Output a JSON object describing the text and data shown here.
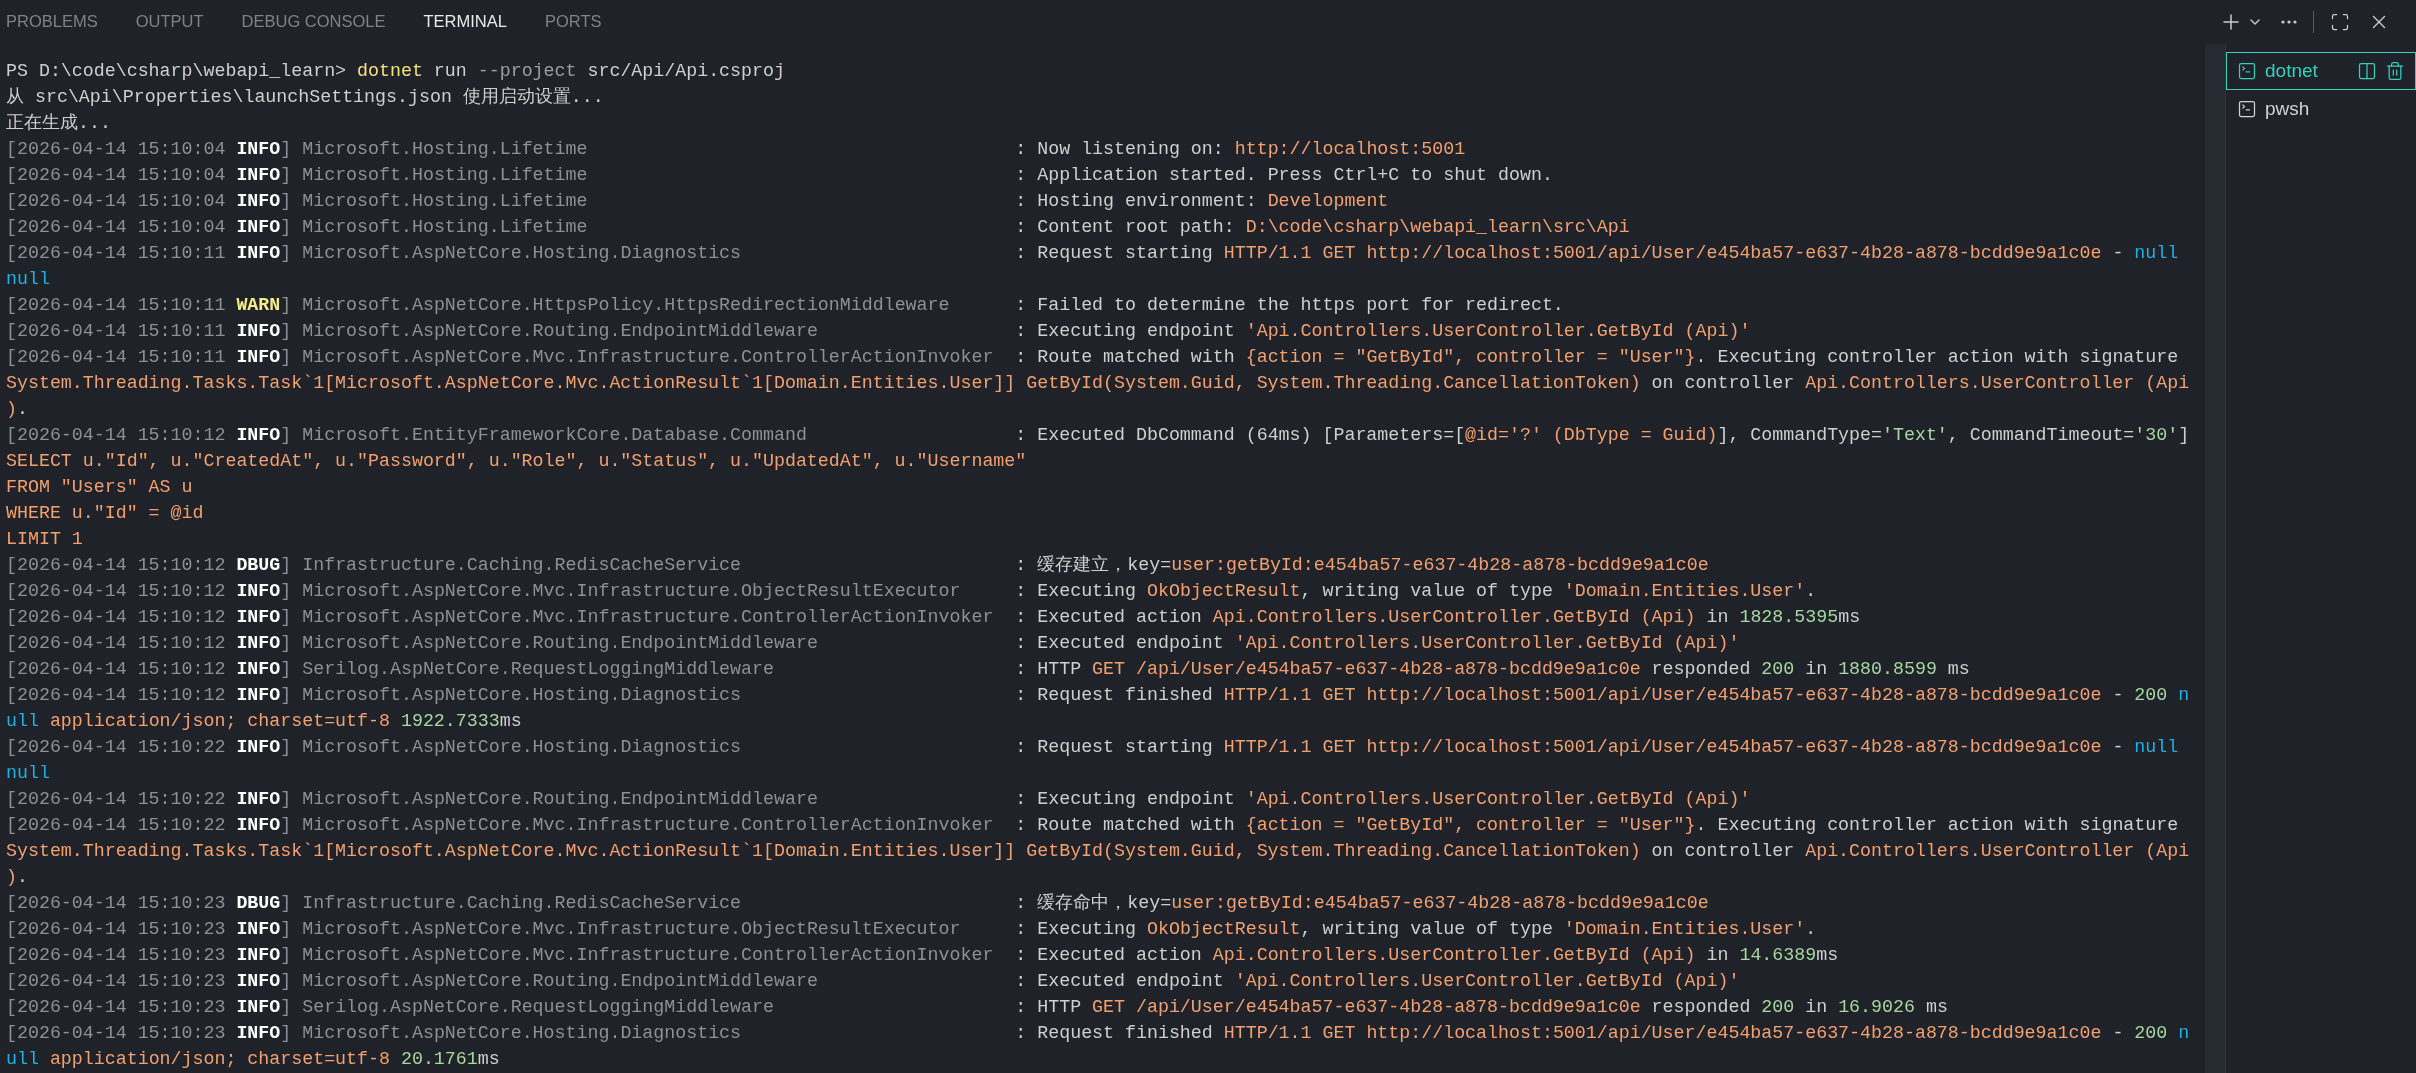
{
  "tabs": [
    {
      "label": "PROBLEMS",
      "selected": false
    },
    {
      "label": "OUTPUT",
      "selected": false
    },
    {
      "label": "DEBUG CONSOLE",
      "selected": false
    },
    {
      "label": "TERMINAL",
      "selected": true
    },
    {
      "label": "PORTS",
      "selected": false
    }
  ],
  "terminals": [
    {
      "label": "dotnet",
      "selected": true
    },
    {
      "label": "pwsh",
      "selected": false
    }
  ],
  "lines": [
    [
      {
        "text": "PS D:\\code\\csharp\\webapi_learn> ",
        "kind": "plain"
      },
      {
        "text": "dotnet",
        "kind": "command"
      },
      {
        "text": " run ",
        "kind": "plain"
      },
      {
        "text": "--project",
        "kind": "option"
      },
      {
        "text": " src/Api/Api.csproj",
        "kind": "plain"
      }
    ],
    [
      {
        "text": "从 src\\Api\\Properties\\launchSettings.json 使用启动设置...",
        "kind": "plain"
      }
    ],
    [
      {
        "text": "正在生成...",
        "kind": "plain"
      }
    ],
    [
      {
        "text": "[2026-04-14 15:10:04 ",
        "kind": "dim"
      },
      {
        "text": "INFO",
        "kind": "level"
      },
      {
        "text": "] ",
        "kind": "dim"
      },
      {
        "text": "Microsoft.Hosting.Lifetime",
        "kind": "source"
      },
      {
        "text": ": Now listening on: ",
        "kind": "plain"
      },
      {
        "text": "http://localhost:5001",
        "kind": "string"
      }
    ],
    [
      {
        "text": "[2026-04-14 15:10:04 ",
        "kind": "dim"
      },
      {
        "text": "INFO",
        "kind": "level"
      },
      {
        "text": "] ",
        "kind": "dim"
      },
      {
        "text": "Microsoft.Hosting.Lifetime",
        "kind": "source"
      },
      {
        "text": ": Application started. Press Ctrl+C to shut down.",
        "kind": "plain"
      }
    ],
    [
      {
        "text": "[2026-04-14 15:10:04 ",
        "kind": "dim"
      },
      {
        "text": "INFO",
        "kind": "level"
      },
      {
        "text": "] ",
        "kind": "dim"
      },
      {
        "text": "Microsoft.Hosting.Lifetime",
        "kind": "source"
      },
      {
        "text": ": Hosting environment: ",
        "kind": "plain"
      },
      {
        "text": "Development",
        "kind": "string"
      }
    ],
    [
      {
        "text": "[2026-04-14 15:10:04 ",
        "kind": "dim"
      },
      {
        "text": "INFO",
        "kind": "level"
      },
      {
        "text": "] ",
        "kind": "dim"
      },
      {
        "text": "Microsoft.Hosting.Lifetime",
        "kind": "source"
      },
      {
        "text": ": Content root path: ",
        "kind": "plain"
      },
      {
        "text": "D:\\code\\csharp\\webapi_learn\\src\\Api",
        "kind": "string"
      }
    ],
    [
      {
        "text": "[2026-04-14 15:10:11 ",
        "kind": "dim"
      },
      {
        "text": "INFO",
        "kind": "level"
      },
      {
        "text": "] ",
        "kind": "dim"
      },
      {
        "text": "Microsoft.AspNetCore.Hosting.Diagnostics",
        "kind": "source"
      },
      {
        "text": ": Request starting ",
        "kind": "plain"
      },
      {
        "text": "HTTP/1.1 GET http://localhost:5001/api/User/e454ba57-e637-4b28-a878-bcdd9e9a1c0e",
        "kind": "string"
      },
      {
        "text": " - ",
        "kind": "plain"
      },
      {
        "text": "null",
        "kind": "null"
      }
    ],
    [
      {
        "text": "null",
        "kind": "null"
      }
    ],
    [
      {
        "text": "[2026-04-14 15:10:11 ",
        "kind": "dim"
      },
      {
        "text": "WARN",
        "kind": "warn"
      },
      {
        "text": "] ",
        "kind": "dim"
      },
      {
        "text": "Microsoft.AspNetCore.HttpsPolicy.HttpsRedirectionMiddleware",
        "kind": "source"
      },
      {
        "text": ": Failed to determine the https port for redirect.",
        "kind": "plain"
      }
    ],
    [
      {
        "text": "[2026-04-14 15:10:11 ",
        "kind": "dim"
      },
      {
        "text": "INFO",
        "kind": "level"
      },
      {
        "text": "] ",
        "kind": "dim"
      },
      {
        "text": "Microsoft.AspNetCore.Routing.EndpointMiddleware",
        "kind": "source"
      },
      {
        "text": ": Executing endpoint ",
        "kind": "plain"
      },
      {
        "text": "'Api.Controllers.UserController.GetById (Api)'",
        "kind": "string"
      }
    ],
    [
      {
        "text": "[2026-04-14 15:10:11 ",
        "kind": "dim"
      },
      {
        "text": "INFO",
        "kind": "level"
      },
      {
        "text": "] ",
        "kind": "dim"
      },
      {
        "text": "Microsoft.AspNetCore.Mvc.Infrastructure.ControllerActionInvoker",
        "kind": "source"
      },
      {
        "text": ": Route matched with ",
        "kind": "plain"
      },
      {
        "text": "{action = \"GetById\", controller = \"User\"}",
        "kind": "string"
      },
      {
        "text": ". Executing controller action with signature",
        "kind": "plain"
      }
    ],
    [
      {
        "text": "System.Threading.Tasks.Task`1[Microsoft.AspNetCore.Mvc.ActionResult`1[Domain.Entities.User]] GetById(System.Guid, System.Threading.CancellationToken)",
        "kind": "string"
      },
      {
        "text": " on controller ",
        "kind": "plain"
      },
      {
        "text": "Api.Controllers.UserController (Api",
        "kind": "string"
      }
    ],
    [
      {
        "text": ")",
        "kind": "string"
      },
      {
        "text": ".",
        "kind": "plain"
      }
    ],
    [
      {
        "text": "[2026-04-14 15:10:12 ",
        "kind": "dim"
      },
      {
        "text": "INFO",
        "kind": "level"
      },
      {
        "text": "] ",
        "kind": "dim"
      },
      {
        "text": "Microsoft.EntityFrameworkCore.Database.Command",
        "kind": "source"
      },
      {
        "text": ": Executed DbCommand (64ms) [Parameters=[",
        "kind": "plain"
      },
      {
        "text": "@id='?' (DbType = Guid)",
        "kind": "string"
      },
      {
        "text": "], CommandType=",
        "kind": "plain"
      },
      {
        "text": "'Text'",
        "kind": "number"
      },
      {
        "text": ", CommandTimeout=",
        "kind": "plain"
      },
      {
        "text": "'30'",
        "kind": "number"
      },
      {
        "text": "]",
        "kind": "plain"
      }
    ],
    [
      {
        "text": "SELECT u.\"Id\", u.\"CreatedAt\", u.\"Password\", u.\"Role\", u.\"Status\", u.\"UpdatedAt\", u.\"Username\"",
        "kind": "string"
      }
    ],
    [
      {
        "text": "FROM \"Users\" AS u",
        "kind": "string"
      }
    ],
    [
      {
        "text": "WHERE u.\"Id\" = @id",
        "kind": "string"
      }
    ],
    [
      {
        "text": "LIMIT 1",
        "kind": "string"
      }
    ],
    [
      {
        "text": "[2026-04-14 15:10:12 ",
        "kind": "dim"
      },
      {
        "text": "DBUG",
        "kind": "level"
      },
      {
        "text": "] ",
        "kind": "dim"
      },
      {
        "text": "Infrastructure.Caching.RedisCacheService",
        "kind": "source"
      },
      {
        "text": ": 缓存建立，key=",
        "kind": "plain"
      },
      {
        "text": "user:getById:e454ba57-e637-4b28-a878-bcdd9e9a1c0e",
        "kind": "string"
      }
    ],
    [
      {
        "text": "[2026-04-14 15:10:12 ",
        "kind": "dim"
      },
      {
        "text": "INFO",
        "kind": "level"
      },
      {
        "text": "] ",
        "kind": "dim"
      },
      {
        "text": "Microsoft.AspNetCore.Mvc.Infrastructure.ObjectResultExecutor",
        "kind": "source"
      },
      {
        "text": ": Executing ",
        "kind": "plain"
      },
      {
        "text": "OkObjectResult",
        "kind": "string"
      },
      {
        "text": ", writing value of type ",
        "kind": "plain"
      },
      {
        "text": "'Domain.Entities.User'",
        "kind": "string"
      },
      {
        "text": ".",
        "kind": "plain"
      }
    ],
    [
      {
        "text": "[2026-04-14 15:10:12 ",
        "kind": "dim"
      },
      {
        "text": "INFO",
        "kind": "level"
      },
      {
        "text": "] ",
        "kind": "dim"
      },
      {
        "text": "Microsoft.AspNetCore.Mvc.Infrastructure.ControllerActionInvoker",
        "kind": "source"
      },
      {
        "text": ": Executed action ",
        "kind": "plain"
      },
      {
        "text": "Api.Controllers.UserController.GetById (Api)",
        "kind": "string"
      },
      {
        "text": " in ",
        "kind": "plain"
      },
      {
        "text": "1828.5395",
        "kind": "number"
      },
      {
        "text": "ms",
        "kind": "plain"
      }
    ],
    [
      {
        "text": "[2026-04-14 15:10:12 ",
        "kind": "dim"
      },
      {
        "text": "INFO",
        "kind": "level"
      },
      {
        "text": "] ",
        "kind": "dim"
      },
      {
        "text": "Microsoft.AspNetCore.Routing.EndpointMiddleware",
        "kind": "source"
      },
      {
        "text": ": Executed endpoint ",
        "kind": "plain"
      },
      {
        "text": "'Api.Controllers.UserController.GetById (Api)'",
        "kind": "string"
      }
    ],
    [
      {
        "text": "[2026-04-14 15:10:12 ",
        "kind": "dim"
      },
      {
        "text": "INFO",
        "kind": "level"
      },
      {
        "text": "] ",
        "kind": "dim"
      },
      {
        "text": "Serilog.AspNetCore.RequestLoggingMiddleware",
        "kind": "source"
      },
      {
        "text": ": HTTP ",
        "kind": "plain"
      },
      {
        "text": "GET /api/User/e454ba57-e637-4b28-a878-bcdd9e9a1c0e",
        "kind": "string"
      },
      {
        "text": " responded ",
        "kind": "plain"
      },
      {
        "text": "200",
        "kind": "number"
      },
      {
        "text": " in ",
        "kind": "plain"
      },
      {
        "text": "1880.8599",
        "kind": "number"
      },
      {
        "text": " ms",
        "kind": "plain"
      }
    ],
    [
      {
        "text": "[2026-04-14 15:10:12 ",
        "kind": "dim"
      },
      {
        "text": "INFO",
        "kind": "level"
      },
      {
        "text": "] ",
        "kind": "dim"
      },
      {
        "text": "Microsoft.AspNetCore.Hosting.Diagnostics",
        "kind": "source"
      },
      {
        "text": ": Request finished ",
        "kind": "plain"
      },
      {
        "text": "HTTP/1.1 GET http://localhost:5001/api/User/e454ba57-e637-4b28-a878-bcdd9e9a1c0e",
        "kind": "string"
      },
      {
        "text": " - ",
        "kind": "plain"
      },
      {
        "text": "200 ",
        "kind": "number"
      },
      {
        "text": "n",
        "kind": "null"
      }
    ],
    [
      {
        "text": "ull ",
        "kind": "null"
      },
      {
        "text": "application/json; charset=utf-8 ",
        "kind": "string"
      },
      {
        "text": "1922.7333",
        "kind": "number"
      },
      {
        "text": "ms",
        "kind": "plain"
      }
    ],
    [
      {
        "text": "[2026-04-14 15:10:22 ",
        "kind": "dim"
      },
      {
        "text": "INFO",
        "kind": "level"
      },
      {
        "text": "] ",
        "kind": "dim"
      },
      {
        "text": "Microsoft.AspNetCore.Hosting.Diagnostics",
        "kind": "source"
      },
      {
        "text": ": Request starting ",
        "kind": "plain"
      },
      {
        "text": "HTTP/1.1 GET http://localhost:5001/api/User/e454ba57-e637-4b28-a878-bcdd9e9a1c0e",
        "kind": "string"
      },
      {
        "text": " - ",
        "kind": "plain"
      },
      {
        "text": "null",
        "kind": "null"
      }
    ],
    [
      {
        "text": "null",
        "kind": "null"
      }
    ],
    [
      {
        "text": "[2026-04-14 15:10:22 ",
        "kind": "dim"
      },
      {
        "text": "INFO",
        "kind": "level"
      },
      {
        "text": "] ",
        "kind": "dim"
      },
      {
        "text": "Microsoft.AspNetCore.Routing.EndpointMiddleware",
        "kind": "source"
      },
      {
        "text": ": Executing endpoint ",
        "kind": "plain"
      },
      {
        "text": "'Api.Controllers.UserController.GetById (Api)'",
        "kind": "string"
      }
    ],
    [
      {
        "text": "[2026-04-14 15:10:22 ",
        "kind": "dim"
      },
      {
        "text": "INFO",
        "kind": "level"
      },
      {
        "text": "] ",
        "kind": "dim"
      },
      {
        "text": "Microsoft.AspNetCore.Mvc.Infrastructure.ControllerActionInvoker",
        "kind": "source"
      },
      {
        "text": ": Route matched with ",
        "kind": "plain"
      },
      {
        "text": "{action = \"GetById\", controller = \"User\"}",
        "kind": "string"
      },
      {
        "text": ". Executing controller action with signature",
        "kind": "plain"
      }
    ],
    [
      {
        "text": "System.Threading.Tasks.Task`1[Microsoft.AspNetCore.Mvc.ActionResult`1[Domain.Entities.User]] GetById(System.Guid, System.Threading.CancellationToken)",
        "kind": "string"
      },
      {
        "text": " on controller ",
        "kind": "plain"
      },
      {
        "text": "Api.Controllers.UserController (Api",
        "kind": "string"
      }
    ],
    [
      {
        "text": ")",
        "kind": "string"
      },
      {
        "text": ".",
        "kind": "plain"
      }
    ],
    [
      {
        "text": "[2026-04-14 15:10:23 ",
        "kind": "dim"
      },
      {
        "text": "DBUG",
        "kind": "level"
      },
      {
        "text": "] ",
        "kind": "dim"
      },
      {
        "text": "Infrastructure.Caching.RedisCacheService",
        "kind": "source"
      },
      {
        "text": ": 缓存命中，key=",
        "kind": "plain"
      },
      {
        "text": "user:getById:e454ba57-e637-4b28-a878-bcdd9e9a1c0e",
        "kind": "string"
      }
    ],
    [
      {
        "text": "[2026-04-14 15:10:23 ",
        "kind": "dim"
      },
      {
        "text": "INFO",
        "kind": "level"
      },
      {
        "text": "] ",
        "kind": "dim"
      },
      {
        "text": "Microsoft.AspNetCore.Mvc.Infrastructure.ObjectResultExecutor",
        "kind": "source"
      },
      {
        "text": ": Executing ",
        "kind": "plain"
      },
      {
        "text": "OkObjectResult",
        "kind": "string"
      },
      {
        "text": ", writing value of type ",
        "kind": "plain"
      },
      {
        "text": "'Domain.Entities.User'",
        "kind": "string"
      },
      {
        "text": ".",
        "kind": "plain"
      }
    ],
    [
      {
        "text": "[2026-04-14 15:10:23 ",
        "kind": "dim"
      },
      {
        "text": "INFO",
        "kind": "level"
      },
      {
        "text": "] ",
        "kind": "dim"
      },
      {
        "text": "Microsoft.AspNetCore.Mvc.Infrastructure.ControllerActionInvoker",
        "kind": "source"
      },
      {
        "text": ": Executed action ",
        "kind": "plain"
      },
      {
        "text": "Api.Controllers.UserController.GetById (Api)",
        "kind": "string"
      },
      {
        "text": " in ",
        "kind": "plain"
      },
      {
        "text": "14.6389",
        "kind": "number"
      },
      {
        "text": "ms",
        "kind": "plain"
      }
    ],
    [
      {
        "text": "[2026-04-14 15:10:23 ",
        "kind": "dim"
      },
      {
        "text": "INFO",
        "kind": "level"
      },
      {
        "text": "] ",
        "kind": "dim"
      },
      {
        "text": "Microsoft.AspNetCore.Routing.EndpointMiddleware",
        "kind": "source"
      },
      {
        "text": ": Executed endpoint ",
        "kind": "plain"
      },
      {
        "text": "'Api.Controllers.UserController.GetById (Api)'",
        "kind": "string"
      }
    ],
    [
      {
        "text": "[2026-04-14 15:10:23 ",
        "kind": "dim"
      },
      {
        "text": "INFO",
        "kind": "level"
      },
      {
        "text": "] ",
        "kind": "dim"
      },
      {
        "text": "Serilog.AspNetCore.RequestLoggingMiddleware",
        "kind": "source"
      },
      {
        "text": ": HTTP ",
        "kind": "plain"
      },
      {
        "text": "GET /api/User/e454ba57-e637-4b28-a878-bcdd9e9a1c0e",
        "kind": "string"
      },
      {
        "text": " responded ",
        "kind": "plain"
      },
      {
        "text": "200",
        "kind": "number"
      },
      {
        "text": " in ",
        "kind": "plain"
      },
      {
        "text": "16.9026",
        "kind": "number"
      },
      {
        "text": " ms",
        "kind": "plain"
      }
    ],
    [
      {
        "text": "[2026-04-14 15:10:23 ",
        "kind": "dim"
      },
      {
        "text": "INFO",
        "kind": "level"
      },
      {
        "text": "] ",
        "kind": "dim"
      },
      {
        "text": "Microsoft.AspNetCore.Hosting.Diagnostics",
        "kind": "source"
      },
      {
        "text": ": Request finished ",
        "kind": "plain"
      },
      {
        "text": "HTTP/1.1 GET http://localhost:5001/api/User/e454ba57-e637-4b28-a878-bcdd9e9a1c0e",
        "kind": "string"
      },
      {
        "text": " - ",
        "kind": "plain"
      },
      {
        "text": "200 ",
        "kind": "number"
      },
      {
        "text": "n",
        "kind": "null"
      }
    ],
    [
      {
        "text": "ull ",
        "kind": "null"
      },
      {
        "text": "application/json; charset=utf-8 ",
        "kind": "string"
      },
      {
        "text": "20.1761",
        "kind": "number"
      },
      {
        "text": "ms",
        "kind": "plain"
      }
    ]
  ]
}
